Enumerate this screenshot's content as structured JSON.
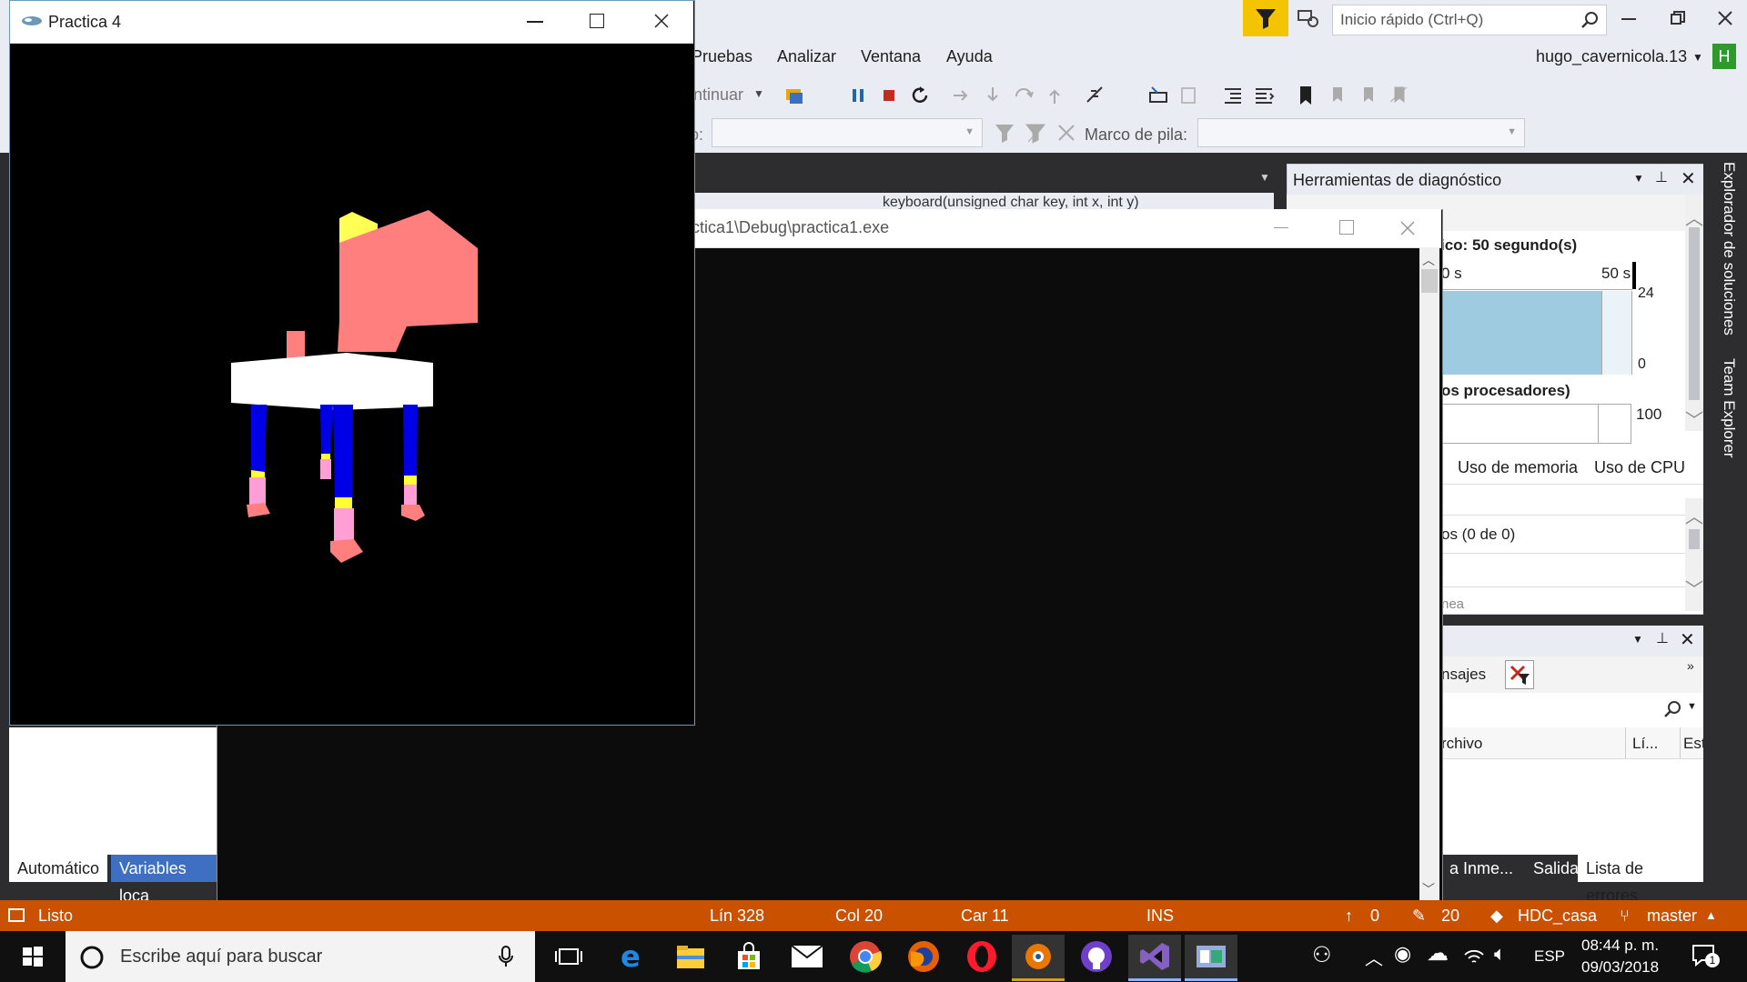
{
  "vs": {
    "quick_launch_placeholder": "Inicio rápido (Ctrl+Q)",
    "user": "hugo_cavernicola.13",
    "user_initial": "H",
    "menu": [
      "Pruebas",
      "Analizar",
      "Ventana",
      "Ayuda"
    ],
    "continue_label": "ntinuar",
    "stack_frame_label": "Marco de pila:",
    "process_label_partial": "o:",
    "func_dropdown": "keyboard(unsigned char key, int x, int y)",
    "bottom_tabs": [
      "Automático",
      "Variables loca"
    ],
    "output_tabs": [
      "a Inme...",
      "Salida",
      "Lista de errores"
    ],
    "side_tabs": [
      "Explorador de soluciones",
      "Team Explorer"
    ]
  },
  "diagnostics": {
    "title": "Herramientas de diagnóstico",
    "session": "ico: 50 segundo(s)",
    "timeline_start": "0 s",
    "timeline_end": "50 s",
    "mem_max": "24",
    "mem_min": "0",
    "cpu_label": "os procesadores)",
    "cpu_max": "100",
    "tab_memory": "Uso de memoria",
    "tab_cpu": "Uso de CPU",
    "events": "os (0 de 0)",
    "line_partial": "nea"
  },
  "errors": {
    "tab_partial": "nsajes",
    "col_file": "rchivo",
    "col_line": "Lí...",
    "col_state": "Est"
  },
  "console": {
    "title": "ctica1\\Debug\\practica1.exe"
  },
  "glut": {
    "title": "Practica 4"
  },
  "status": {
    "ready": "Listo",
    "line": "Lín 328",
    "col": "Col 20",
    "char": "Car 11",
    "mode": "INS",
    "up_count": "0",
    "edit_count": "20",
    "repo": "HDC_casa",
    "branch": "master"
  },
  "taskbar": {
    "search_placeholder": "Escribe aquí para buscar",
    "lang": "ESP",
    "time": "08:44 p. m.",
    "date": "09/03/2018",
    "notif_count": "1"
  },
  "colors": {
    "status_orange": "#ca5100",
    "accent_yellow": "#f5c400",
    "chair_seat": "#ffffff",
    "chair_back": "#ff7f7f",
    "leg_blue": "#0000e6",
    "leg_pink": "#ff9fd6",
    "leg_yellow": "#ffff33"
  }
}
